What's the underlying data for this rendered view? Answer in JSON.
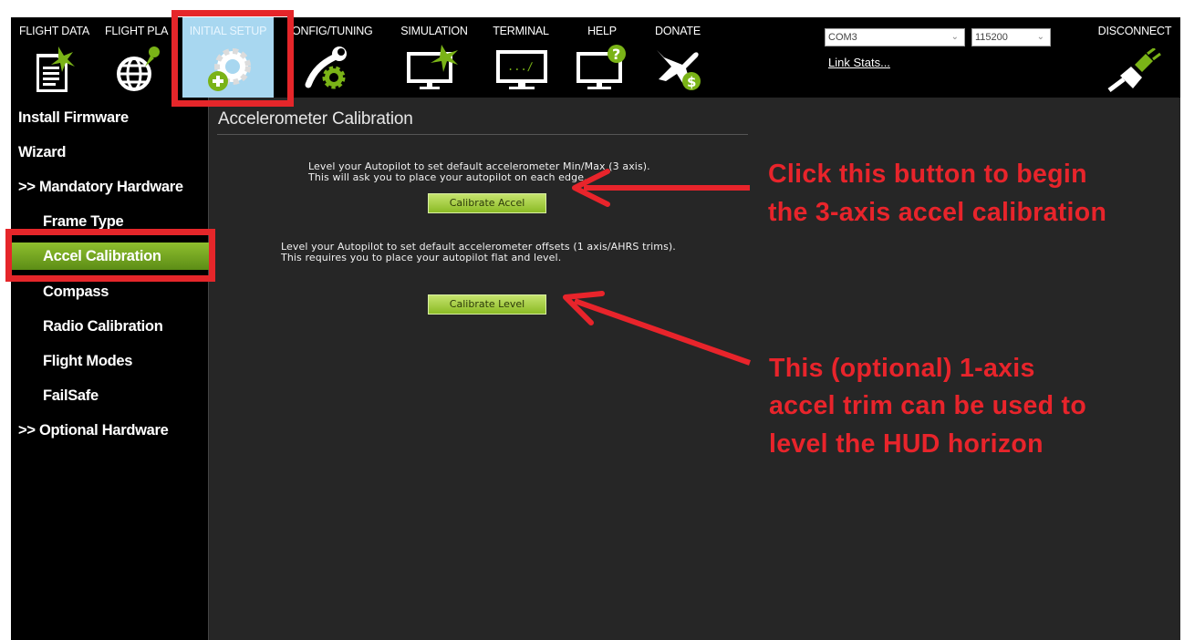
{
  "menu": {
    "items": [
      {
        "label": "FLIGHT DATA",
        "icon": "flight-data-icon"
      },
      {
        "label": "FLIGHT PLA",
        "icon": "flight-plan-icon"
      },
      {
        "label": "INITIAL SETUP",
        "icon": "initial-setup-icon",
        "active": true
      },
      {
        "label": "ONFIG/TUNING",
        "icon": "config-tuning-icon"
      },
      {
        "label": "SIMULATION",
        "icon": "simulation-icon"
      },
      {
        "label": "TERMINAL",
        "icon": "terminal-icon"
      },
      {
        "label": "HELP",
        "icon": "help-icon"
      },
      {
        "label": "DONATE",
        "icon": "donate-icon"
      }
    ],
    "port": {
      "value": "COM3"
    },
    "baud": {
      "value": "115200"
    },
    "link_stats": "Link Stats...",
    "disconnect": "DISCONNECT"
  },
  "sidebar": {
    "items": [
      {
        "label": "Install Firmware",
        "level": "top"
      },
      {
        "label": "Wizard",
        "level": "top"
      },
      {
        "label": ">> Mandatory Hardware",
        "level": "top"
      },
      {
        "label": "Frame Type",
        "level": "sub"
      },
      {
        "label": "Accel Calibration",
        "level": "sub",
        "active": true
      },
      {
        "label": "Compass",
        "level": "sub"
      },
      {
        "label": "Radio Calibration",
        "level": "sub"
      },
      {
        "label": "Flight Modes",
        "level": "sub"
      },
      {
        "label": "FailSafe",
        "level": "sub"
      },
      {
        "label": ">> Optional Hardware",
        "level": "top"
      }
    ]
  },
  "content": {
    "title": "Accelerometer Calibration",
    "accel": {
      "line1": "Level your Autopilot to set default accelerometer Min/Max (3 axis).",
      "line2": "This will ask you to place your autopilot on each edge.",
      "button": "Calibrate Accel"
    },
    "level": {
      "line1": "Level your Autopilot to set default accelerometer offsets (1 axis/AHRS trims).",
      "line2": "This requires you to place your autopilot flat and level.",
      "button": "Calibrate Level"
    }
  },
  "annotations": {
    "first": [
      "Click this button to begin",
      "the 3-axis accel calibration"
    ],
    "second": [
      "This (optional) 1-axis",
      "accel trim can be used to",
      "level the HUD horizon"
    ]
  },
  "colors": {
    "annotation_red": "#e8242b",
    "accent_green": "#8bbb25",
    "active_tab": "#a8d7f0"
  }
}
